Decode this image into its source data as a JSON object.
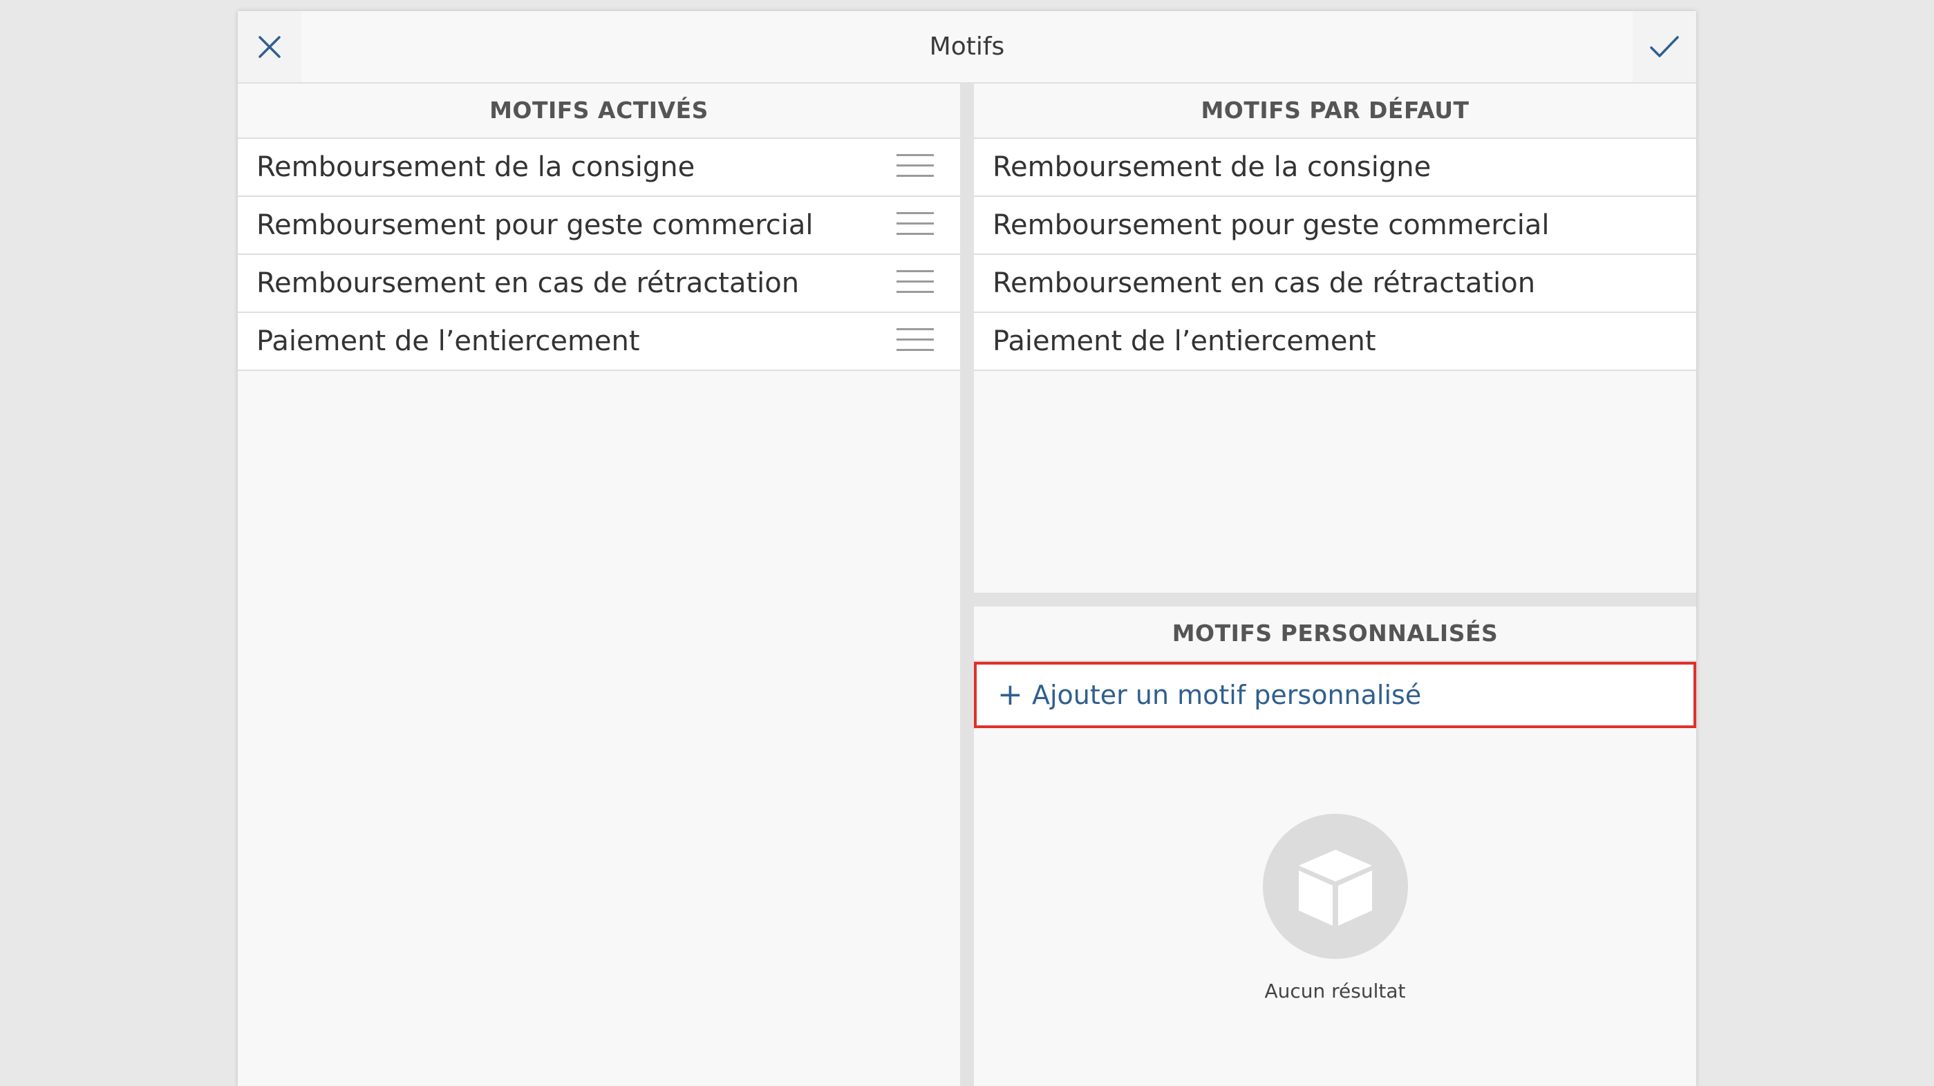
{
  "header": {
    "title": "Motifs",
    "close_icon": "close-icon",
    "confirm_icon": "check-icon"
  },
  "enabled": {
    "heading": "MOTIFS ACTIVÉS",
    "items": [
      {
        "label": "Remboursement de la consigne"
      },
      {
        "label": "Remboursement pour geste commercial"
      },
      {
        "label": "Remboursement en cas de rétractation"
      },
      {
        "label": "Paiement de l’entiercement"
      }
    ]
  },
  "defaults": {
    "heading": "MOTIFS PAR DÉFAUT",
    "items": [
      {
        "label": "Remboursement de la consigne"
      },
      {
        "label": "Remboursement pour geste commercial"
      },
      {
        "label": "Remboursement en cas de rétractation"
      },
      {
        "label": "Paiement de l’entiercement"
      }
    ]
  },
  "custom": {
    "heading": "MOTIFS PERSONNALISÉS",
    "add_symbol": "+",
    "add_label": "Ajouter un motif personnalisé",
    "empty_icon": "box-icon",
    "empty_text": "Aucun résultat"
  },
  "colors": {
    "accent": "#2f5f8f",
    "highlight_border": "#e0302a"
  }
}
